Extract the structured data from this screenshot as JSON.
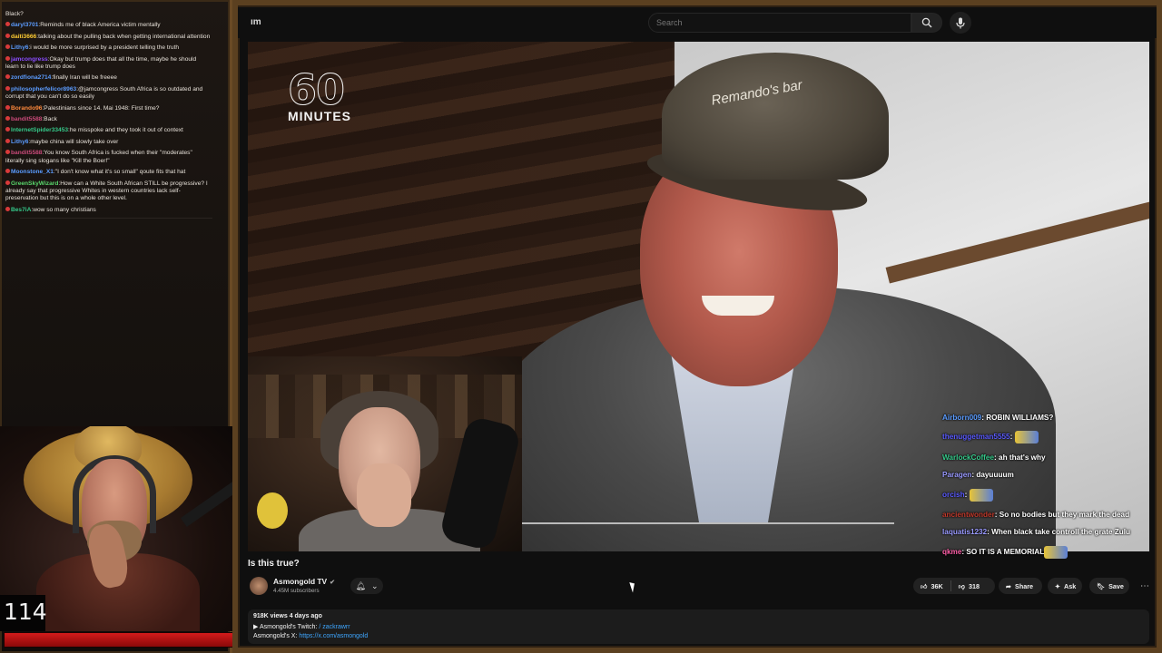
{
  "stream_chat": {
    "lines": [
      {
        "user": "",
        "text": "Black?",
        "color": "#e8e2da"
      },
      {
        "user": "daryl3701",
        "text": "Reminds me of black America victim mentally",
        "color": "#5b9cff"
      },
      {
        "user": "daiti3666",
        "text": "talking about the pulling back when getting international attention",
        "color": "#ffcc33"
      },
      {
        "user": "Lithy6",
        "text": "i would be more surprised by a president telling the truth",
        "color": "#5b9cff"
      },
      {
        "user": "jamcongress",
        "text": "Okay but trump does that all the time, maybe he should learn to lie like trump does",
        "color": "#8a4dff"
      },
      {
        "user": "zordfiona2714",
        "text": "finally Iran will be freeee",
        "color": "#5b9cff"
      },
      {
        "user": "philosopherfelicor8963",
        "text": "@jamcongress South Africa is so outdated and corrupt that you can't do so easily",
        "color": "#5b9cff"
      },
      {
        "user": "Borando96",
        "text": "Palestinians since 14. Mai 1948: First time?",
        "color": "#ff8a3d"
      },
      {
        "user": "bandit5588",
        "text": "Back",
        "color": "#c94a7a"
      },
      {
        "user": "InternetSpider33453",
        "text": "he misspoke and they took it out of context",
        "color": "#35c98a"
      },
      {
        "user": "Lithy6",
        "text": "maybe china will slowly take over",
        "color": "#5b9cff"
      },
      {
        "user": "bandit5588",
        "text": "You know South Africa is fucked when their \"moderates\" literally sing slogans like \"Kill the Boer!\"",
        "color": "#c94a7a"
      },
      {
        "user": "Moonstone_X1",
        "text": "\"I don't know what it's so small\" qoute fits that hat",
        "color": "#5b9cff"
      },
      {
        "user": "GreenSkyWizard",
        "text": "How can a White South African STILL be progressive? I already say that progressive Whites in western countries lack self-preservation but this is on a whole other level.",
        "color": "#59d66b"
      },
      {
        "user": "Bes7iA",
        "text": "wow so many christians",
        "color": "#35c98a"
      }
    ],
    "counter": "114",
    "health_percent": 100
  },
  "youtube": {
    "logo_fragment": "ım",
    "search_placeholder": "Search",
    "video": {
      "logo_number": "60",
      "logo_word": "MINUTES",
      "cap_text": "Remando's bar"
    },
    "overlay_chat": [
      {
        "user": "Airborn009",
        "text": "ROBIN WILLIAMS?",
        "user_color": "#5b9cff"
      },
      {
        "user": "thenuggetman5555",
        "text": "",
        "user_color": "#5b5bff",
        "emote": true
      },
      {
        "user": "WarlockCoffee",
        "text": "ah that's why",
        "user_color": "#35c98a"
      },
      {
        "user": "Paragen",
        "text": "dayuuuum",
        "user_color": "#9a9aff"
      },
      {
        "user": "orcish",
        "text": "",
        "user_color": "#5b5bff",
        "emote": true
      },
      {
        "user": "ancientwonder",
        "text": "So no bodies but they mark the dead",
        "user_color": "#c0392b"
      },
      {
        "user": "laquatis1232",
        "text": "When black take controll the grate Zulu",
        "user_color": "#9a9aff"
      },
      {
        "user": "qkme",
        "text": "SO IT IS A MEMORIAL",
        "user_color": "#ff5fa8",
        "emote": true
      }
    ],
    "title": "Is this true?",
    "channel": {
      "name": "Asmongold TV",
      "subscribers": "4.45M subscribers"
    },
    "actions": {
      "likes": "36K",
      "dislikes": "318",
      "share": "Share",
      "ask": "Ask",
      "save": "Save"
    },
    "description": {
      "meta": "918K views  4 days ago",
      "twitch_label": "▶ Asmongold's Twitch:",
      "twitch_handle": "/ zackrawrr",
      "x_label": "Asmongold's X:",
      "x_link": "https://x.com/asmongold"
    }
  }
}
